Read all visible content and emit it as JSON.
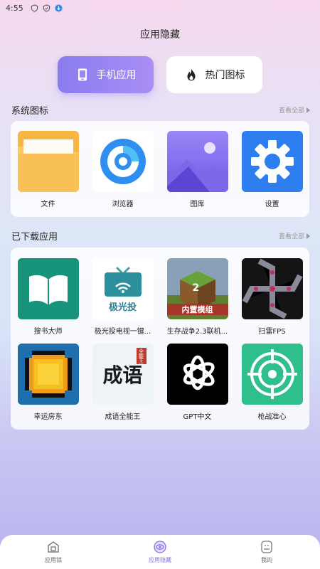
{
  "status": {
    "time": "4:55"
  },
  "page_title": "应用隐藏",
  "segments": {
    "phone_apps": "手机应用",
    "hot_icons": "热门图标"
  },
  "system": {
    "title": "系统图标",
    "more": "查看全部",
    "apps": [
      {
        "label": "文件",
        "icon": "folder-icon"
      },
      {
        "label": "浏览器",
        "icon": "browser-icon"
      },
      {
        "label": "图库",
        "icon": "gallery-icon"
      },
      {
        "label": "设置",
        "icon": "settings-icon"
      }
    ]
  },
  "downloaded": {
    "title": "已下载应用",
    "more": "查看全部",
    "apps": [
      {
        "label": "搜书大师",
        "icon": "book-icon"
      },
      {
        "label": "极光投电视一键...",
        "icon": "tv-cast-icon",
        "tile_text": "极光投"
      },
      {
        "label": "生存战争2.3联机...",
        "icon": "game-block-icon",
        "tile_text": "内置模组",
        "tile_number": "2"
      },
      {
        "label": "扫雷FPS",
        "icon": "minesweeper-icon"
      },
      {
        "label": "幸运房东",
        "icon": "coin-icon"
      },
      {
        "label": "成语全能王",
        "icon": "idiom-icon",
        "tile_text": "成语",
        "tile_tag": "全能王"
      },
      {
        "label": "GPT中文",
        "icon": "openai-icon"
      },
      {
        "label": "枪战准心",
        "icon": "crosshair-icon"
      }
    ]
  },
  "tabs": [
    {
      "label": "应用锁",
      "icon": "lock-icon"
    },
    {
      "label": "应用隐藏",
      "icon": "hide-icon"
    },
    {
      "label": "我的",
      "icon": "profile-icon"
    }
  ],
  "colors": {
    "accent": "#8a7cf0",
    "active_tab": "#8a6fe6"
  }
}
